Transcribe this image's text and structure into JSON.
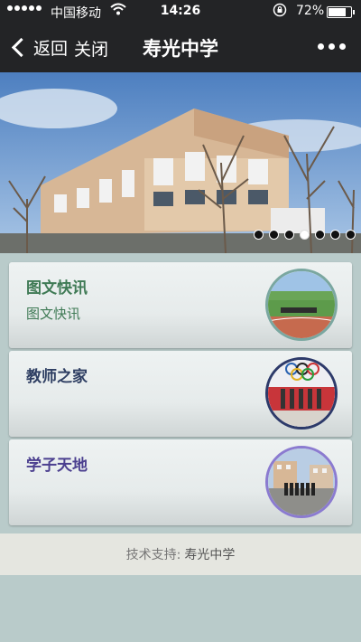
{
  "status_bar": {
    "carrier": "中国移动",
    "time": "14:26",
    "battery": "72%"
  },
  "nav": {
    "back_label": "返回",
    "close_label": "关闭",
    "title": "寿光中学"
  },
  "carousel": {
    "slide_count": 7,
    "active_index": 3
  },
  "cards": [
    {
      "title": "图文快讯",
      "subtitle": "图文快讯",
      "title_color": "#3f7a55",
      "ring_color": "#7aa7a0",
      "image": "sports-field-photo"
    },
    {
      "title": "教师之家",
      "subtitle": "",
      "title_color": "#2f3f63",
      "ring_color": "#2d3a6a",
      "image": "olympic-stage-photo"
    },
    {
      "title": "学子天地",
      "subtitle": "",
      "title_color": "#4b3f8f",
      "ring_color": "#8b7bd0",
      "image": "campus-group-photo"
    }
  ],
  "footer": {
    "label": "技术支持:",
    "value": "寿光中学"
  }
}
